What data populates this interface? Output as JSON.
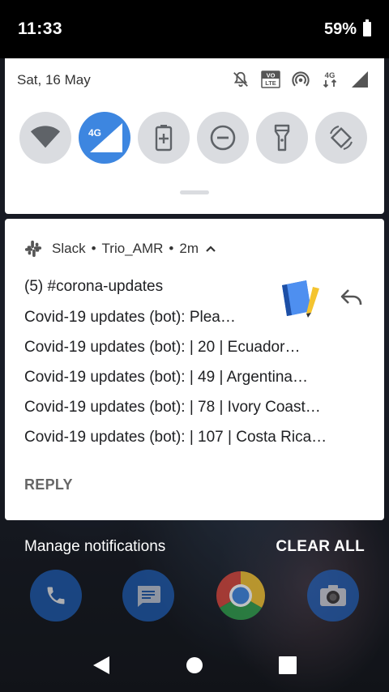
{
  "status_bar": {
    "time": "11:33",
    "battery_percent": "59%",
    "battery_icon": "battery-icon"
  },
  "quick_settings": {
    "date": "Sat, 16 May",
    "status_icons": [
      "notifications-off-icon",
      "volte-icon",
      "hotspot-icon",
      "data-4g-icon",
      "signal-icon"
    ],
    "volte_label": "VO LTE",
    "data_label": "4G",
    "tiles": [
      {
        "name": "wifi",
        "icon": "wifi-icon",
        "active": false
      },
      {
        "name": "mobile-data",
        "icon": "mobile-data-icon",
        "label": "4G",
        "active": true
      },
      {
        "name": "battery-saver",
        "icon": "battery-saver-icon",
        "active": false
      },
      {
        "name": "do-not-disturb",
        "icon": "do-not-disturb-icon",
        "active": false
      },
      {
        "name": "flashlight",
        "icon": "flashlight-icon",
        "active": false
      },
      {
        "name": "auto-rotate",
        "icon": "auto-rotate-icon",
        "active": false
      }
    ],
    "accent_color": "#3d86e0"
  },
  "notification": {
    "app_name": "Slack",
    "separator": "•",
    "workspace": "Trio_AMR",
    "time": "2m",
    "title": "(5) #corona-updates",
    "lines": [
      "Covid-19 updates (bot): Plea…",
      "Covid-19 updates (bot): | 20     | Ecuador…",
      "Covid-19 updates (bot): | 49     | Argentina…",
      "Covid-19 updates (bot): | 78     | Ivory Coast…",
      "Covid-19 updates (bot): | 107    | Costa Rica…"
    ],
    "reply_label": "REPLY"
  },
  "actions": {
    "manage": "Manage notifications",
    "clear_all": "CLEAR ALL"
  },
  "dock": [
    "phone-icon",
    "messages-icon",
    "chrome-icon",
    "camera-icon"
  ],
  "nav": [
    "back-icon",
    "home-icon",
    "recents-icon"
  ]
}
